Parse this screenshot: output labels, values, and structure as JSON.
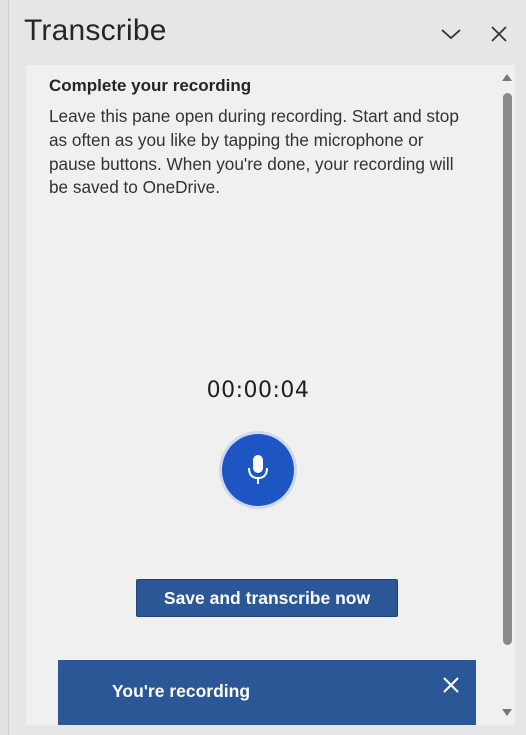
{
  "pane": {
    "title": "Transcribe",
    "collapse_icon": "chevron-down-icon",
    "close_icon": "close-icon"
  },
  "content": {
    "heading": "Complete your recording",
    "body": "Leave this pane open during recording. Start and stop as often as you like by tapping the microphone or pause buttons. When you're done, your recording will be saved to OneDrive.",
    "timer": "00:00:04",
    "mic_icon": "microphone-icon",
    "save_button_label": "Save and transcribe now"
  },
  "toast": {
    "message": "You're recording",
    "close_icon": "close-icon"
  },
  "colors": {
    "accent": "#2b5797",
    "mic_blue": "#1d55c2",
    "mic_ring": "#cfd9ee",
    "pane_bg": "#e6e6e6",
    "content_bg": "#f0f0f0"
  }
}
